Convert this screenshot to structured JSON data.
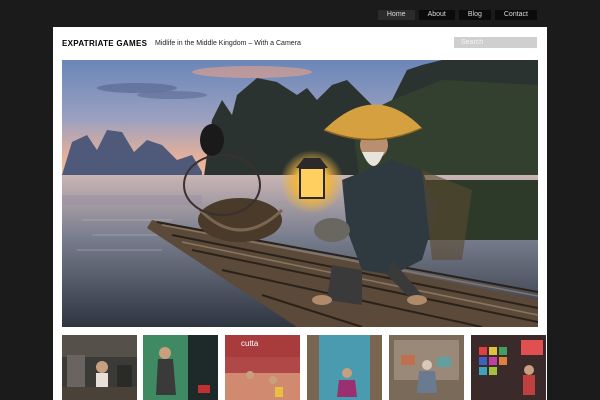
{
  "nav": {
    "items": [
      {
        "label": "Home"
      },
      {
        "label": "About"
      },
      {
        "label": "Blog"
      },
      {
        "label": "Contact"
      }
    ]
  },
  "header": {
    "site_title": "EXPATRIATE GAMES",
    "tagline": "Midlife in the Middle Kingdom – With a Camera"
  },
  "search": {
    "placeholder": "Search"
  },
  "thumbnails": {
    "count": 6,
    "caption_text_3": "cutta"
  },
  "colors": {
    "page_background": "#1b1b1b",
    "nav_background": "#0b0b0b",
    "panel_background": "#ffffff",
    "search_background": "#cfcfcf"
  }
}
